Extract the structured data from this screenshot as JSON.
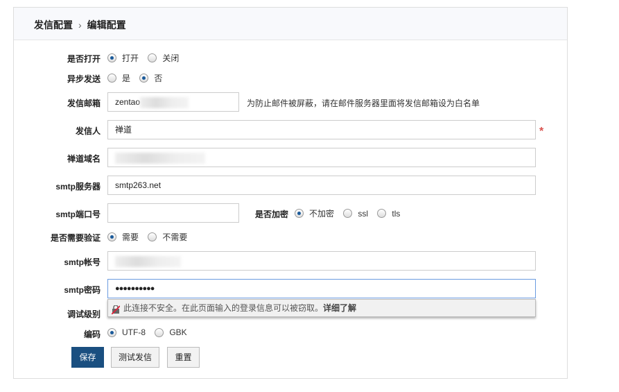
{
  "breadcrumb": {
    "parent": "发信配置",
    "current": "编辑配置"
  },
  "form": {
    "turnon": {
      "label": "是否打开",
      "options": [
        "打开",
        "关闭"
      ],
      "selected": "打开"
    },
    "async": {
      "label": "异步发送",
      "options": [
        "是",
        "否"
      ],
      "selected": "否"
    },
    "from_address": {
      "label": "发信邮箱",
      "value": "zentao",
      "hint": "为防止邮件被屏蔽，请在邮件服务器里面将发信邮箱设为白名单"
    },
    "from_name": {
      "label": "发信人",
      "value": "禅道",
      "required": "*"
    },
    "domain": {
      "label": "禅道域名",
      "value": ""
    },
    "host": {
      "label": "smtp服务器",
      "value": "smtp263.net"
    },
    "port": {
      "label": "smtp端口号",
      "value": ""
    },
    "secure": {
      "label": "是否加密",
      "options": [
        "不加密",
        "ssl",
        "tls"
      ],
      "selected": "不加密"
    },
    "auth": {
      "label": "是否需要验证",
      "options": [
        "需要",
        "不需要"
      ],
      "selected": "需要"
    },
    "username": {
      "label": "smtp帐号",
      "value": ""
    },
    "password": {
      "label": "smtp密码",
      "value": "●●●●●●●●●●"
    },
    "debug": {
      "label": "调试级别"
    },
    "charset": {
      "label": "编码",
      "options": [
        "UTF-8",
        "GBK"
      ],
      "selected": "UTF-8"
    }
  },
  "tooltip": {
    "text": "此连接不安全。在此页面输入的登录信息可以被窃取。",
    "link": "详细了解"
  },
  "buttons": {
    "save": "保存",
    "test": "测试发信",
    "reset": "重置"
  },
  "colors": {
    "primary": "#1a4f80",
    "required": "#d9534f"
  }
}
